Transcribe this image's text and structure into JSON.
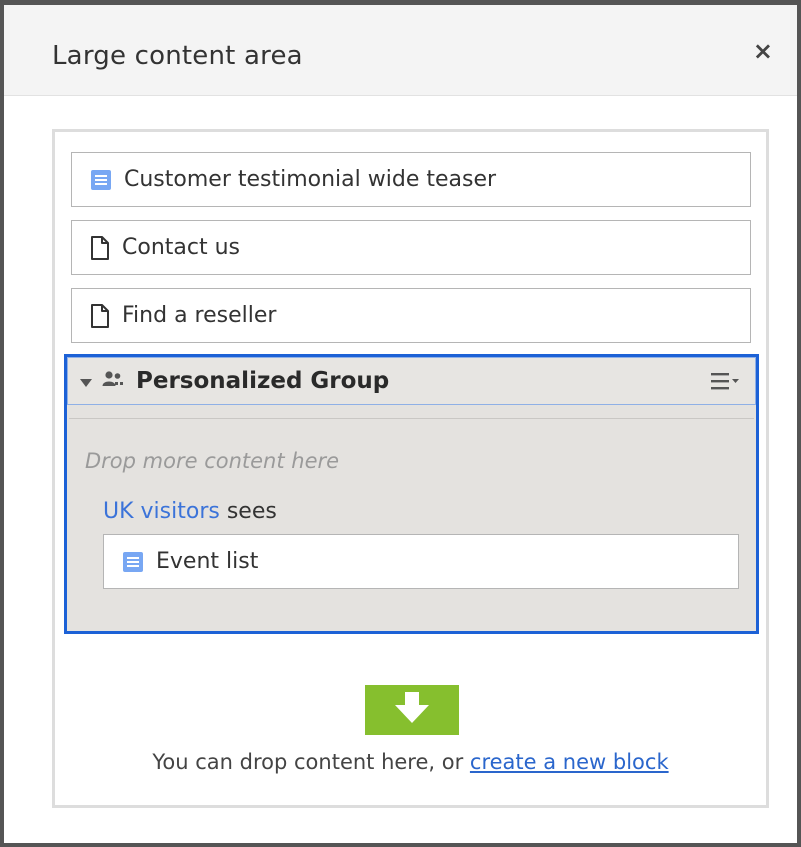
{
  "dialog": {
    "title": "Large content area",
    "close_label": "×"
  },
  "blocks": [
    {
      "label": "Customer testimonial wide teaser",
      "icon": "block-icon"
    },
    {
      "label": "Contact us",
      "icon": "page-icon"
    },
    {
      "label": "Find a reseller",
      "icon": "page-icon"
    }
  ],
  "group": {
    "title": "Personalized Group",
    "drop_hint": "Drop more content here",
    "audience_link": "UK visitors",
    "audience_suffix": " sees",
    "item": {
      "label": "Event list",
      "icon": "block-icon"
    }
  },
  "footer": {
    "text": "You can drop content here, or ",
    "link": "create a new block"
  },
  "colors": {
    "accent_blue": "#1c61d6",
    "drop_green": "#86bf2e",
    "block_icon_blue": "#78a7f3"
  }
}
